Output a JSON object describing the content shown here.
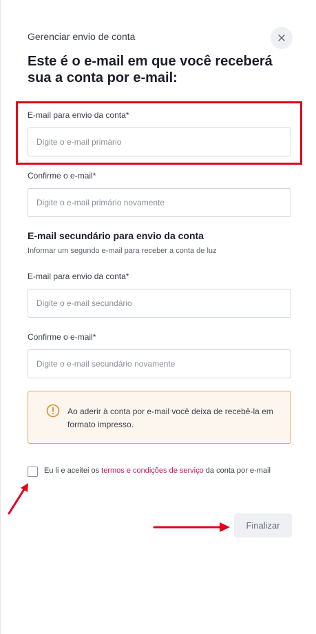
{
  "header": {
    "subtitle": "Gerenciar envio de conta",
    "title": "Este é o e-mail em que você receberá sua a conta por e-mail:"
  },
  "primary": {
    "email_label": "E-mail para envio da conta*",
    "email_placeholder": "Digite o e-mail primário",
    "confirm_label": "Confirme o e-mail*",
    "confirm_placeholder": "Digite o e-mail primário novamente"
  },
  "secondary": {
    "section_title": "E-mail secundário para envio da conta",
    "section_desc": "Informar um segundo e-mail para receber a conta de luz",
    "email_label": "E-mail para envio da conta*",
    "email_placeholder": "Digite o e-mail secundário",
    "confirm_label": "Confirme o e-mail*",
    "confirm_placeholder": "Digite o e-mail secundário novamente"
  },
  "warning": {
    "icon": "alert-circle-icon",
    "text": "Ao aderir à conta por e-mail você deixa de recebê-la em formato impresso."
  },
  "terms": {
    "prefix": "Eu li e aceitei os ",
    "link": "termos e condições de serviço",
    "suffix": " da conta por e-mail",
    "checked": false
  },
  "actions": {
    "finish_label": "Finalizar"
  },
  "colors": {
    "accent_link": "#c2185b",
    "warning_border": "#e9a55a",
    "annotation_red": "#e3001b"
  }
}
